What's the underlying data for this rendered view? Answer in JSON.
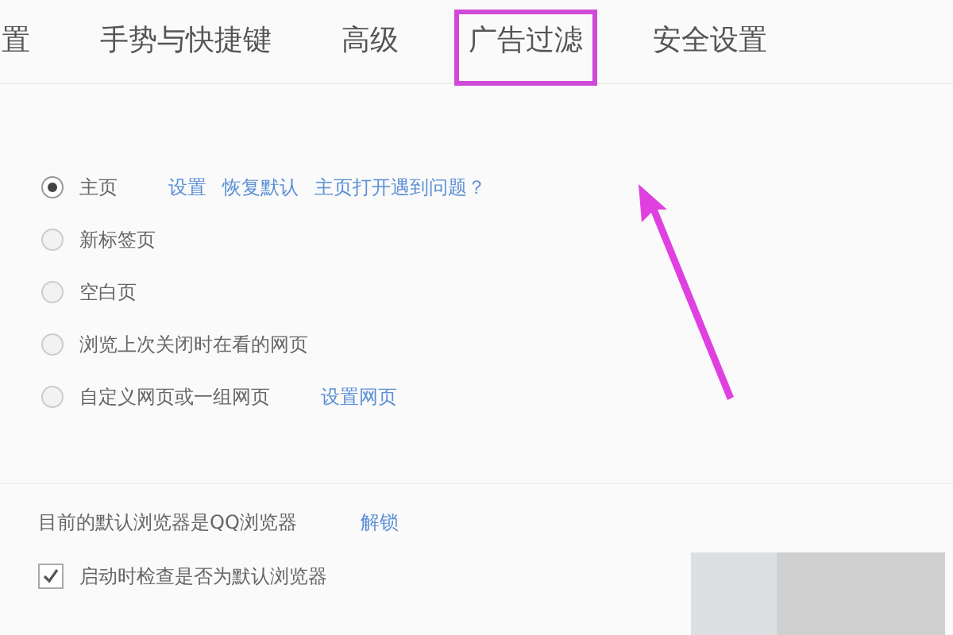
{
  "tabs": [
    {
      "label": "置",
      "highlighted": false
    },
    {
      "label": "手势与快捷键",
      "highlighted": false
    },
    {
      "label": "高级",
      "highlighted": false
    },
    {
      "label": "广告过滤",
      "highlighted": true
    },
    {
      "label": "安全设置",
      "highlighted": false
    }
  ],
  "startup_options": [
    {
      "label": "主页",
      "selected": true,
      "links": [
        "设置",
        "恢复默认",
        "主页打开遇到问题？"
      ]
    },
    {
      "label": "新标签页",
      "selected": false
    },
    {
      "label": "空白页",
      "selected": false
    },
    {
      "label": "浏览上次关闭时在看的网页",
      "selected": false
    },
    {
      "label": "自定义网页或一组网页",
      "selected": false,
      "links": [
        "设置网页"
      ]
    }
  ],
  "default_browser": {
    "status": "目前的默认浏览器是QQ浏览器",
    "action_link": "解锁",
    "check_on_startup": {
      "label": "启动时检查是否为默认浏览器",
      "checked": true
    }
  }
}
